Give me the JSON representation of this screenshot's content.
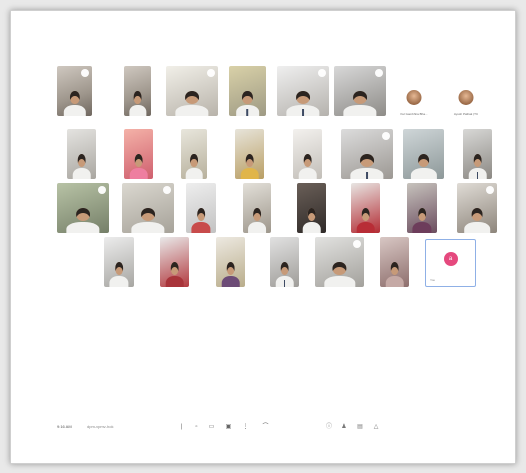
{
  "meeting": {
    "time": "9:16 AM",
    "code": "dpm-vpmv-hok"
  },
  "participants": {
    "avatar_1_name": "Kul Gambhira Bha...",
    "avatar_2_name": "Ayush Pathak (TC",
    "you_initial": "a",
    "you_label": "You"
  },
  "icons": {
    "mic": "mic-icon",
    "camera": "camera-icon",
    "captions": "captions-icon",
    "present": "present-screen-icon",
    "more": "more-options-icon",
    "leave": "end-call-icon",
    "info": "meeting-info-icon",
    "people": "people-icon",
    "chat": "chat-icon",
    "activities": "activities-icon"
  }
}
